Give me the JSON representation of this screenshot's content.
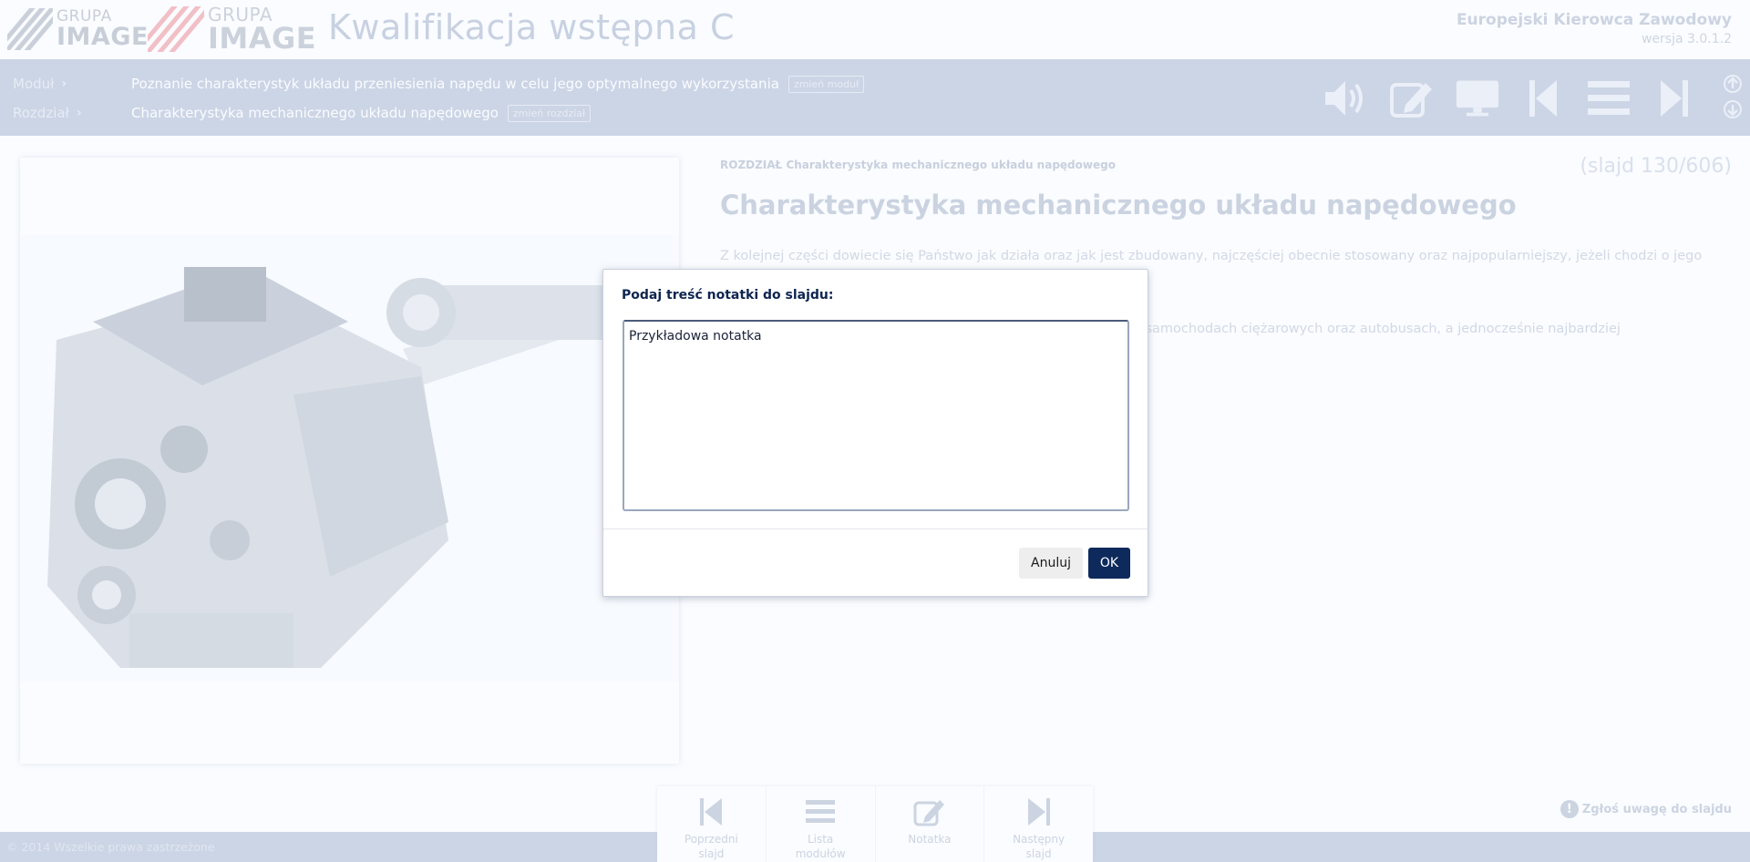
{
  "header": {
    "logo1": {
      "line1": "GRUPA",
      "line2": "IMAGE"
    },
    "logo2": {
      "line1": "GRUPA",
      "line2": "IMAGE"
    },
    "app_title": "Kwalifikacja wstępna C",
    "product_name": "Europejski Kierowca Zawodowy",
    "version": "wersja 3.0.1.2"
  },
  "navbar": {
    "module_label": "Moduł",
    "module_value": "Poznanie charakterystyk układu przeniesienia napędu w celu jego optymalnego wykorzystania",
    "module_change": "zmień moduł",
    "chapter_label": "Rozdział",
    "chapter_value": "Charakterystyka mechanicznego układu napędowego",
    "chapter_change": "zmień rozdział",
    "icons": [
      "speaker-icon",
      "edit-note-icon",
      "monitor-icon",
      "previous-icon",
      "menu-icon",
      "next-icon"
    ]
  },
  "slide": {
    "chapter_line": "ROZDZIAŁ Charakterystyka mechanicznego układu napędowego",
    "counter": "(slajd 130/606)",
    "title": "Charakterystyka mechanicznego układu napędowego",
    "paragraph1": "Z kolejnej części dowiecie się Państwo jak działa oraz jak jest zbudowany, najczęściej obecnie stosowany oraz najpopularniejszy, jeżeli chodzi o jego",
    "paragraph2": "w samochodach ciężarowych oraz autobusach, a jednocześnie najbardziej"
  },
  "report": {
    "label": "Zgłoś uwagę do slajdu"
  },
  "bottom_nav": {
    "prev": {
      "line1": "Poprzedni",
      "line2": "slajd"
    },
    "list": {
      "line1": "Lista",
      "line2": "modułów"
    },
    "note": {
      "line1": "Notatka",
      "line2": ""
    },
    "next": {
      "line1": "Następny",
      "line2": "slajd"
    }
  },
  "footer": {
    "copyright": "© 2014 Wszelkie prawa zastrzeżone"
  },
  "dialog": {
    "label": "Podaj treść notatki do slajdu:",
    "textarea_value": "Przykładowa notatka",
    "cancel_label": "Anuluj",
    "ok_label": "OK"
  },
  "colors": {
    "navbar": "#b9c3d8",
    "ok_button": "#0e2a5c",
    "dialog_label": "#0e2550"
  }
}
